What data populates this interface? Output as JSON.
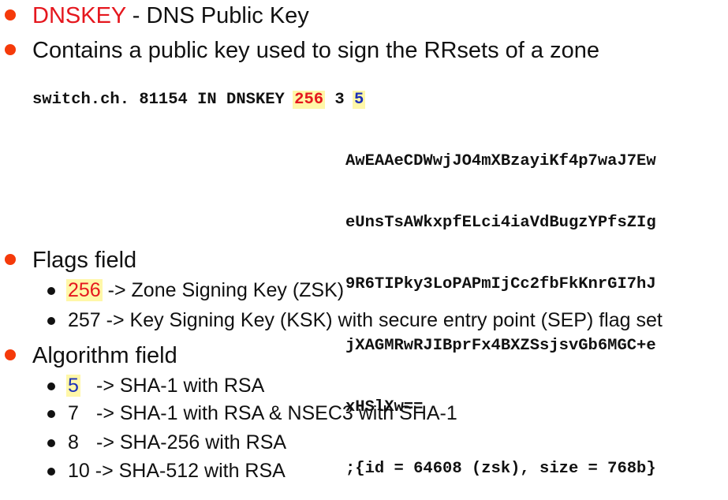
{
  "bullets_top": [
    {
      "keyword": "DNSKEY",
      "text": " - DNS Public Key"
    },
    {
      "text": "Contains a public key used to sign the RRsets of a zone"
    }
  ],
  "code": {
    "prefix": "switch.ch. 81154 IN DNSKEY ",
    "flags": "256",
    "protocol": "3",
    "algorithm": "5",
    "key_lines": [
      "AwEAAeCDWwjJO4mXBzayiKf4p7waJ7Ew",
      "eUnsTsAWkxpfELci4iaVdBugzYPfsZIg",
      "9R6TIPky3LoPAPmIjCc2fbFkKnrGI7hJ",
      "jXAGMRwRJIBprFx4BXZSsjsvGb6MGC+e",
      "xHSlXw==",
      ";{id = 64608 (zsk), size = 768b}"
    ]
  },
  "flags_field": {
    "title": "Flags field",
    "items": [
      {
        "value": "256",
        "text": " -> Zone Signing Key (ZSK)"
      },
      {
        "value": "257",
        "text": " -> Key Signing Key (KSK) with secure entry point (SEP) flag set"
      }
    ]
  },
  "algorithm_field": {
    "title": "Algorithm field",
    "items": [
      {
        "value": "5",
        "text": "-> SHA-1 with RSA"
      },
      {
        "value": "7",
        "text": "-> SHA-1 with RSA & NSEC3 with SHA-1"
      },
      {
        "value": "8",
        "text": "-> SHA-256 with RSA"
      },
      {
        "value": "10",
        "text": "-> SHA-512 with RSA"
      }
    ]
  },
  "colors": {
    "bullet_orange": "#f53a0a",
    "keyword_red": "#e5171e",
    "highlight_yellow": "#fff7a8",
    "algorithm_blue": "#1a2fb8"
  }
}
